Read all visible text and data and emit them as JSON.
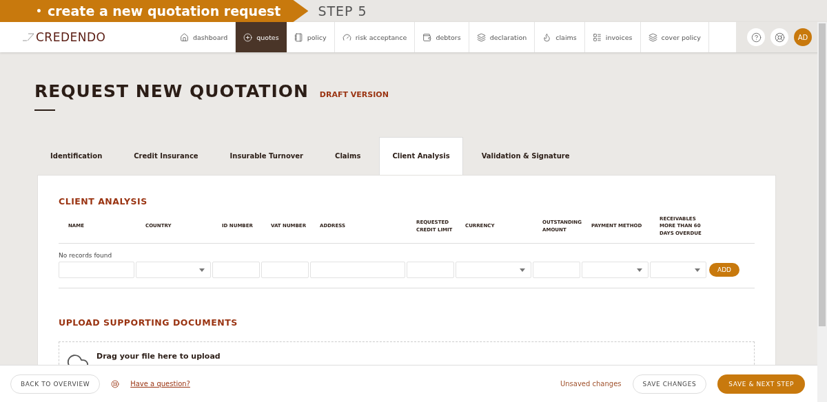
{
  "banner": {
    "bullet": "•",
    "title": "create a new quotation request",
    "step": "STEP 5"
  },
  "logo": "CREDENDO",
  "nav": [
    {
      "label": "dashboard",
      "selected": false
    },
    {
      "label": "quotes",
      "selected": true
    },
    {
      "label": "policy",
      "selected": false
    },
    {
      "label": "risk acceptance",
      "selected": false
    },
    {
      "label": "debtors",
      "selected": false
    },
    {
      "label": "declaration",
      "selected": false
    },
    {
      "label": "claims",
      "selected": false
    },
    {
      "label": "invoices",
      "selected": false
    },
    {
      "label": "cover policy",
      "selected": false
    }
  ],
  "user": {
    "initials": "AD"
  },
  "page": {
    "title": "REQUEST NEW QUOTATION",
    "badge": "DRAFT VERSION"
  },
  "tabs": [
    {
      "label": "Identification",
      "selected": false
    },
    {
      "label": "Credit Insurance",
      "selected": false
    },
    {
      "label": "Insurable Turnover",
      "selected": false
    },
    {
      "label": "Claims",
      "selected": false
    },
    {
      "label": "Client Analysis",
      "selected": true
    },
    {
      "label": "Validation & Signature",
      "selected": false
    }
  ],
  "client_analysis": {
    "title": "CLIENT ANALYSIS",
    "columns": [
      {
        "label": "NAME",
        "kind": "text"
      },
      {
        "label": "COUNTRY",
        "kind": "select"
      },
      {
        "label": "ID NUMBER",
        "kind": "text"
      },
      {
        "label": "VAT NUMBER",
        "kind": "text"
      },
      {
        "label": "ADDRESS",
        "kind": "text"
      },
      {
        "label": "REQUESTED CREDIT LIMIT",
        "kind": "text"
      },
      {
        "label": "CURRENCY",
        "kind": "select"
      },
      {
        "label": "OUTSTANDING AMOUNT",
        "kind": "text"
      },
      {
        "label": "PAYMENT METHOD",
        "kind": "select"
      },
      {
        "label": "RECEIVABLES MORE THAN 60 DAYS OVERDUE",
        "kind": "select"
      }
    ],
    "empty": "No records found",
    "add_button": "ADD"
  },
  "upload": {
    "title": "UPLOAD SUPPORTING DOCUMENTS",
    "drop_text": "Drag your file here to upload"
  },
  "footer": {
    "back": "BACK TO OVERVIEW",
    "help": "Have a question?",
    "status": "Unsaved changes",
    "save": "SAVE CHANGES",
    "next": "SAVE & NEXT STEP"
  }
}
